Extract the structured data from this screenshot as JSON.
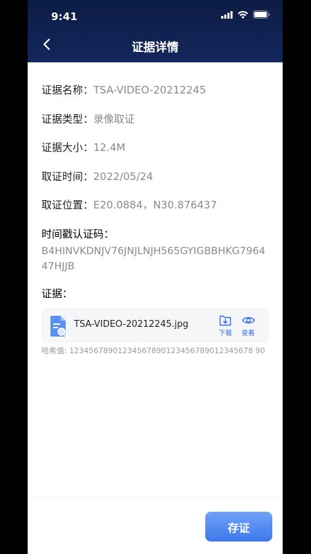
{
  "status_bar": {
    "time": "9:41"
  },
  "header": {
    "title": "证据详情"
  },
  "details": {
    "name_label": "证据名称：",
    "name_value": "TSA-VIDEO-20212245",
    "type_label": "证据类型：",
    "type_value": "录像取证",
    "size_label": "证据大小：",
    "size_value": "12.4M",
    "time_label": "取证时间：",
    "time_value": "2022/05/24",
    "location_label": "取证位置：",
    "location_value": "E20.0884，N30.876437",
    "token_label": "时间戳认证码：",
    "token_value": "B4HINVKDNJV76JNJLNJH565GYIGBBHKG796447HJJB",
    "evidence_label": "证据："
  },
  "file": {
    "name": "TSA-VIDEO-20212245.jpg",
    "download_label": "下载",
    "view_label": "查看",
    "hash_text": "哈希值: 12345678901234567890123456789012345678 90"
  },
  "footer": {
    "save_label": "存证"
  },
  "colors": {
    "header_bg": "#0c1c44",
    "accent": "#2f6ae8",
    "button": "#5a8ff0"
  }
}
